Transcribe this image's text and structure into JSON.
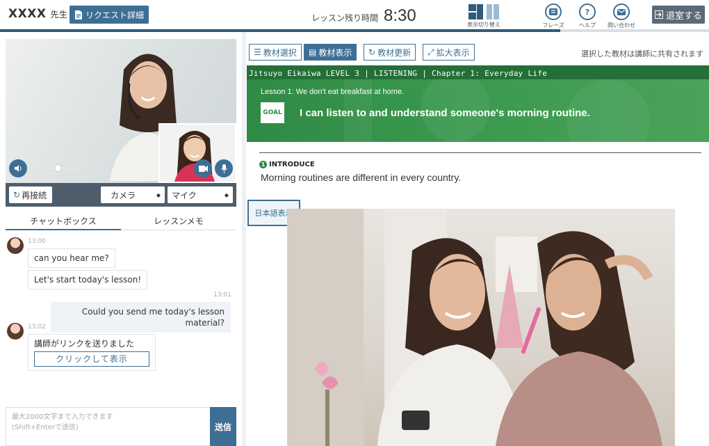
{
  "header": {
    "teacher_name": "XXXX",
    "teacher_suffix": "先生",
    "request_button": "リクエスト詳細",
    "remaining_label": "レッスン残り時間",
    "remaining_time": "8:30",
    "view_switch_label": "表示切り替え",
    "phrase_label": "フレーズ",
    "help_label": "ヘルプ",
    "contact_label": "問い合わせ",
    "exit_button": "退室する",
    "lesson_progress": 0.79
  },
  "video": {
    "reconnect_button": "再接続",
    "camera_select": "カメラ",
    "mic_select": "マイク"
  },
  "tabs": {
    "chat": "チャットボックス",
    "memo": "レッスンメモ"
  },
  "chat": {
    "messages": [
      {
        "time": "13:00",
        "text": "can you hear me?"
      },
      {
        "text": "Let's start today's lesson!"
      },
      {
        "time": "13:01",
        "text": "Could you send me today's lesson material?"
      },
      {
        "time": "13:02",
        "text": "講師がリンクを送りました",
        "link_label": "クリックして表示"
      }
    ],
    "input_placeholder_line1": "最大2000文字まで入力できます",
    "input_placeholder_line2": "(Shift+Enterで送信)",
    "send_button": "送信"
  },
  "toolbar": {
    "select_material": "教材選択",
    "show_material": "教材表示",
    "refresh_material": "教材更新",
    "enlarge": "拡大表示",
    "share_note": "選択した教材は講師に共有されます"
  },
  "material": {
    "course_strip": "Jitsuyo Eikaiwa LEVEL 3 | LISTENING | Chapter 1: Everyday Life",
    "lesson_title": "Lesson 1: We don't eat breakfast at home.",
    "goal_badge": "GOAL",
    "goal_text": "I can listen to and understand someone's morning routine.",
    "section_number": "1",
    "section_label": "INTRODUCE",
    "intro_text": "Morning routines are different in every country.",
    "japanese_toggle": "日本語表示"
  },
  "colors": {
    "accent": "#3d6f95",
    "banner_green": "#2f8a45",
    "banner_strip": "#236f37"
  }
}
